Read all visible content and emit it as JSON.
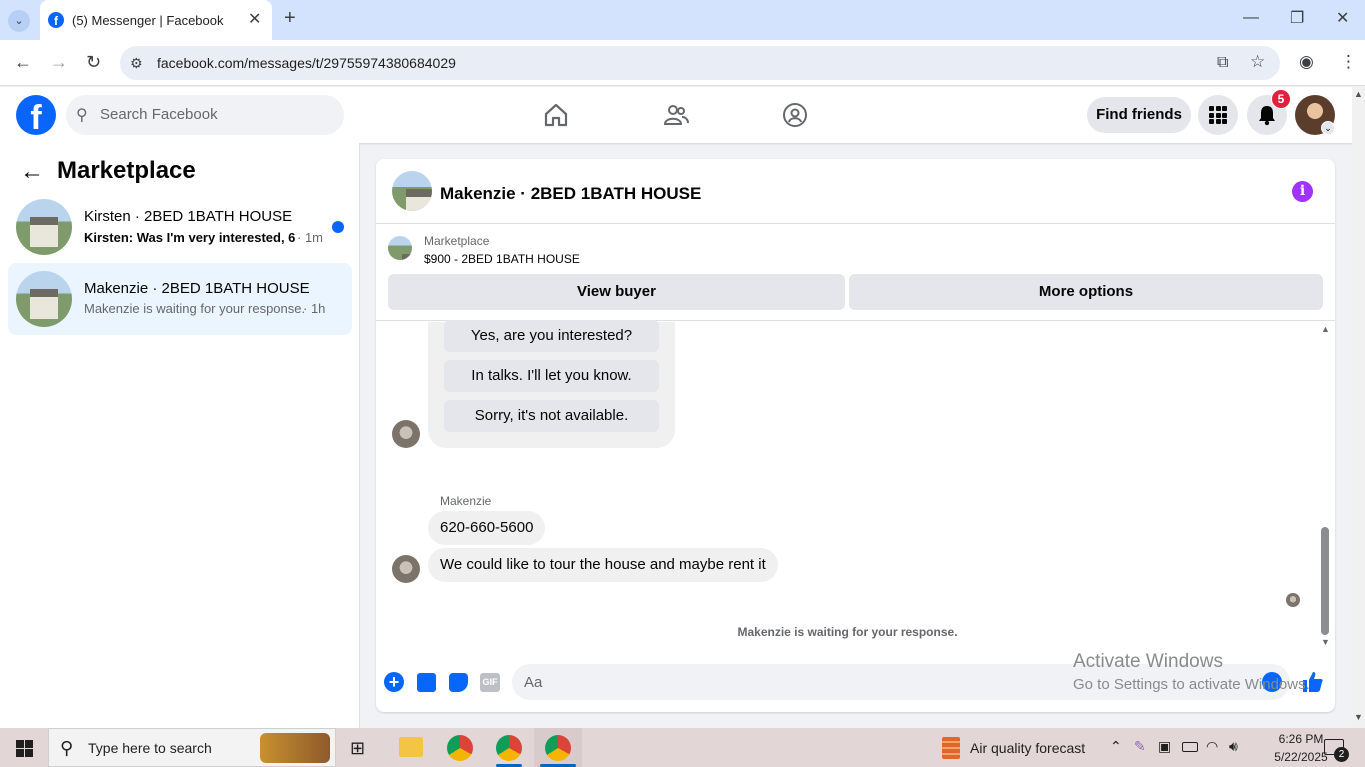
{
  "browser": {
    "tab_title": "(5) Messenger | Facebook",
    "url": "facebook.com/messages/t/29755974380684029"
  },
  "header": {
    "logo": "f",
    "search_placeholder": "Search Facebook",
    "find_friends_label": "Find friends",
    "notification_count": "5"
  },
  "sidebar": {
    "title": "Marketplace",
    "conversations": [
      {
        "name": "Kirsten · 2BED 1BATH HOUSE",
        "snippet": "Kirsten: Was I'm very interested, 6...",
        "time": "· 1m",
        "unread": true
      },
      {
        "name": "Makenzie · 2BED 1BATH HOUSE",
        "snippet": "Makenzie is waiting for your response.",
        "time": "· 1h",
        "unread": false
      }
    ]
  },
  "chat": {
    "title": "Makenzie · 2BED 1BATH HOUSE",
    "marketplace_label": "Marketplace",
    "listing": "$900 - 2BED 1BATH HOUSE",
    "view_buyer_label": "View buyer",
    "more_options_label": "More options",
    "quick_replies": [
      "Yes, are you interested?",
      "In talks. I'll let you know.",
      "Sorry, it's not available."
    ],
    "sender_name": "Makenzie",
    "messages": [
      "620-660-5600",
      "We could like to tour the house and maybe rent it"
    ],
    "waiting_text": "Makenzie is waiting for your response.",
    "composer_placeholder": "Aa",
    "gif_label": "GIF"
  },
  "watermark": {
    "line1": "Activate Windows",
    "line2": "Go to Settings to activate Windows."
  },
  "taskbar": {
    "search_placeholder": "Type here to search",
    "weather": "Air quality forecast",
    "time": "6:26 PM",
    "date": "5/22/2025",
    "notification_count": "2"
  },
  "colors": {
    "facebook_blue": "#0866ff",
    "notification_red": "#e41e3f",
    "info_purple": "#a033ff",
    "chrome_tabstrip": "#d3e3fd"
  }
}
